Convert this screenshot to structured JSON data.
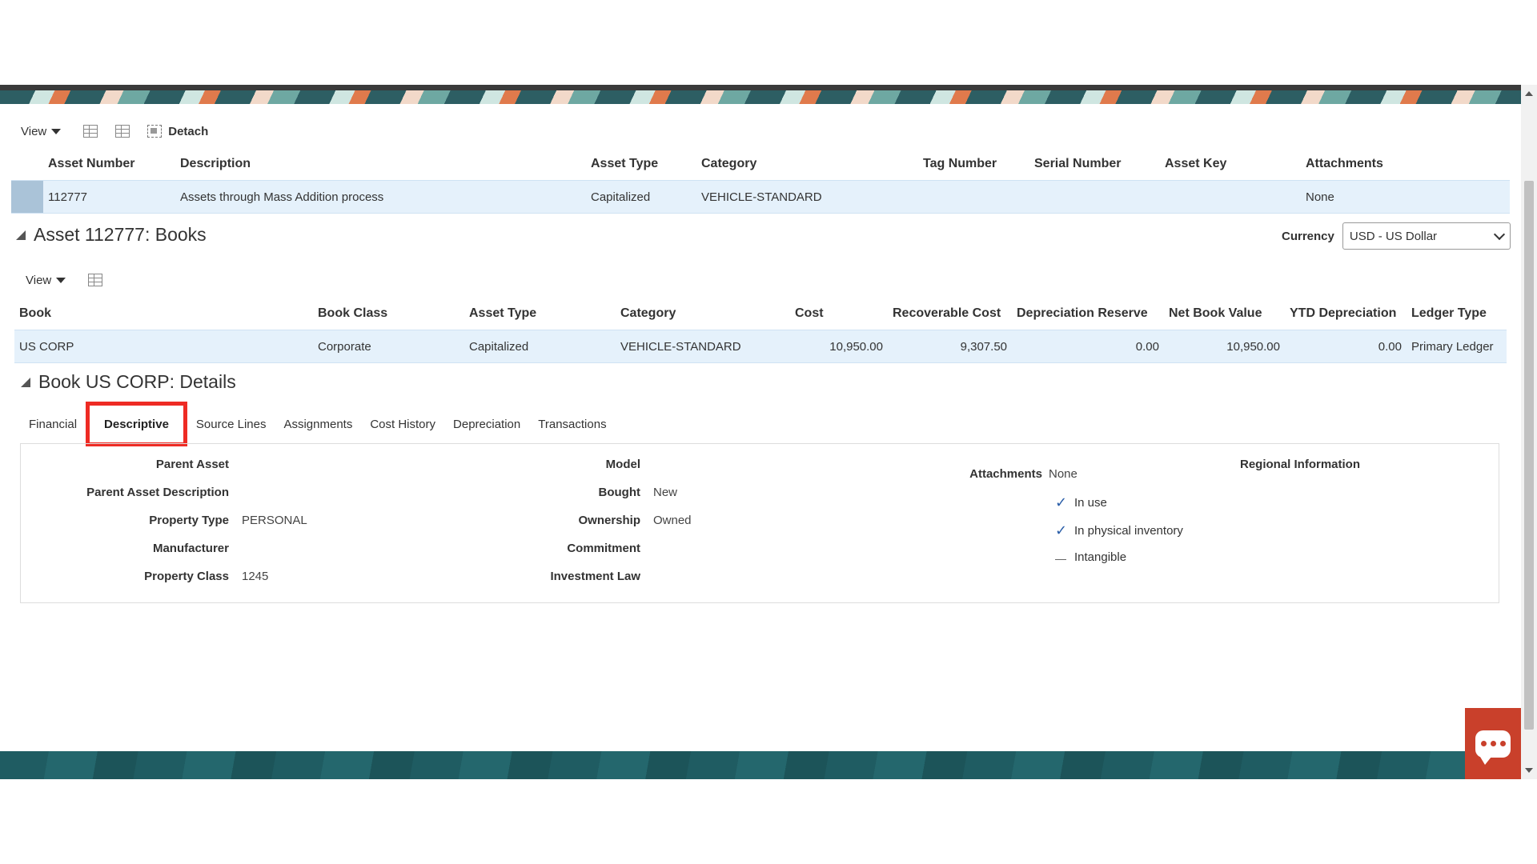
{
  "toolbar1": {
    "view_label": "View",
    "detach_label": "Detach"
  },
  "assets_table": {
    "columns": [
      "Asset Number",
      "Description",
      "Asset Type",
      "Category",
      "Tag Number",
      "Serial Number",
      "Asset Key",
      "Attachments"
    ],
    "row": {
      "asset_number": "112777",
      "description": "Assets through Mass Addition process",
      "asset_type": "Capitalized",
      "category": "VEHICLE-STANDARD",
      "tag_number": "",
      "serial_number": "",
      "asset_key": "",
      "attachments": "None"
    }
  },
  "books_section": {
    "title": "Asset 112777: Books",
    "currency_label": "Currency",
    "currency_value": "USD - US Dollar",
    "view_label": "View",
    "columns": [
      "Book",
      "Book Class",
      "Asset Type",
      "Category",
      "Cost",
      "Recoverable Cost",
      "Depreciation Reserve",
      "Net Book Value",
      "YTD Depreciation",
      "Ledger Type"
    ],
    "row": {
      "book": "US CORP",
      "book_class": "Corporate",
      "asset_type": "Capitalized",
      "category": "VEHICLE-STANDARD",
      "cost": "10,950.00",
      "recoverable_cost": "9,307.50",
      "depreciation_reserve": "0.00",
      "net_book_value": "10,950.00",
      "ytd_depreciation": "0.00",
      "ledger_type": "Primary Ledger"
    }
  },
  "details_section": {
    "title": "Book US CORP: Details",
    "tabs": [
      "Financial",
      "Descriptive",
      "Source Lines",
      "Assignments",
      "Cost History",
      "Depreciation",
      "Transactions"
    ],
    "active_tab": "Descriptive"
  },
  "descriptive": {
    "col1": [
      {
        "label": "Parent Asset",
        "value": ""
      },
      {
        "label": "Parent Asset Description",
        "value": ""
      },
      {
        "label": "Property Type",
        "value": "PERSONAL"
      },
      {
        "label": "Manufacturer",
        "value": ""
      },
      {
        "label": "Property Class",
        "value": "1245"
      }
    ],
    "col2": [
      {
        "label": "Model",
        "value": ""
      },
      {
        "label": "Bought",
        "value": "New"
      },
      {
        "label": "Ownership",
        "value": "Owned"
      },
      {
        "label": "Commitment",
        "value": ""
      },
      {
        "label": "Investment Law",
        "value": ""
      }
    ],
    "attachments_label": "Attachments",
    "attachments_value": "None",
    "checks": [
      {
        "label": "In use",
        "checked": true
      },
      {
        "label": "In physical inventory",
        "checked": true
      },
      {
        "label": "Intangible",
        "checked": false
      }
    ],
    "regional_label": "Regional Information"
  }
}
